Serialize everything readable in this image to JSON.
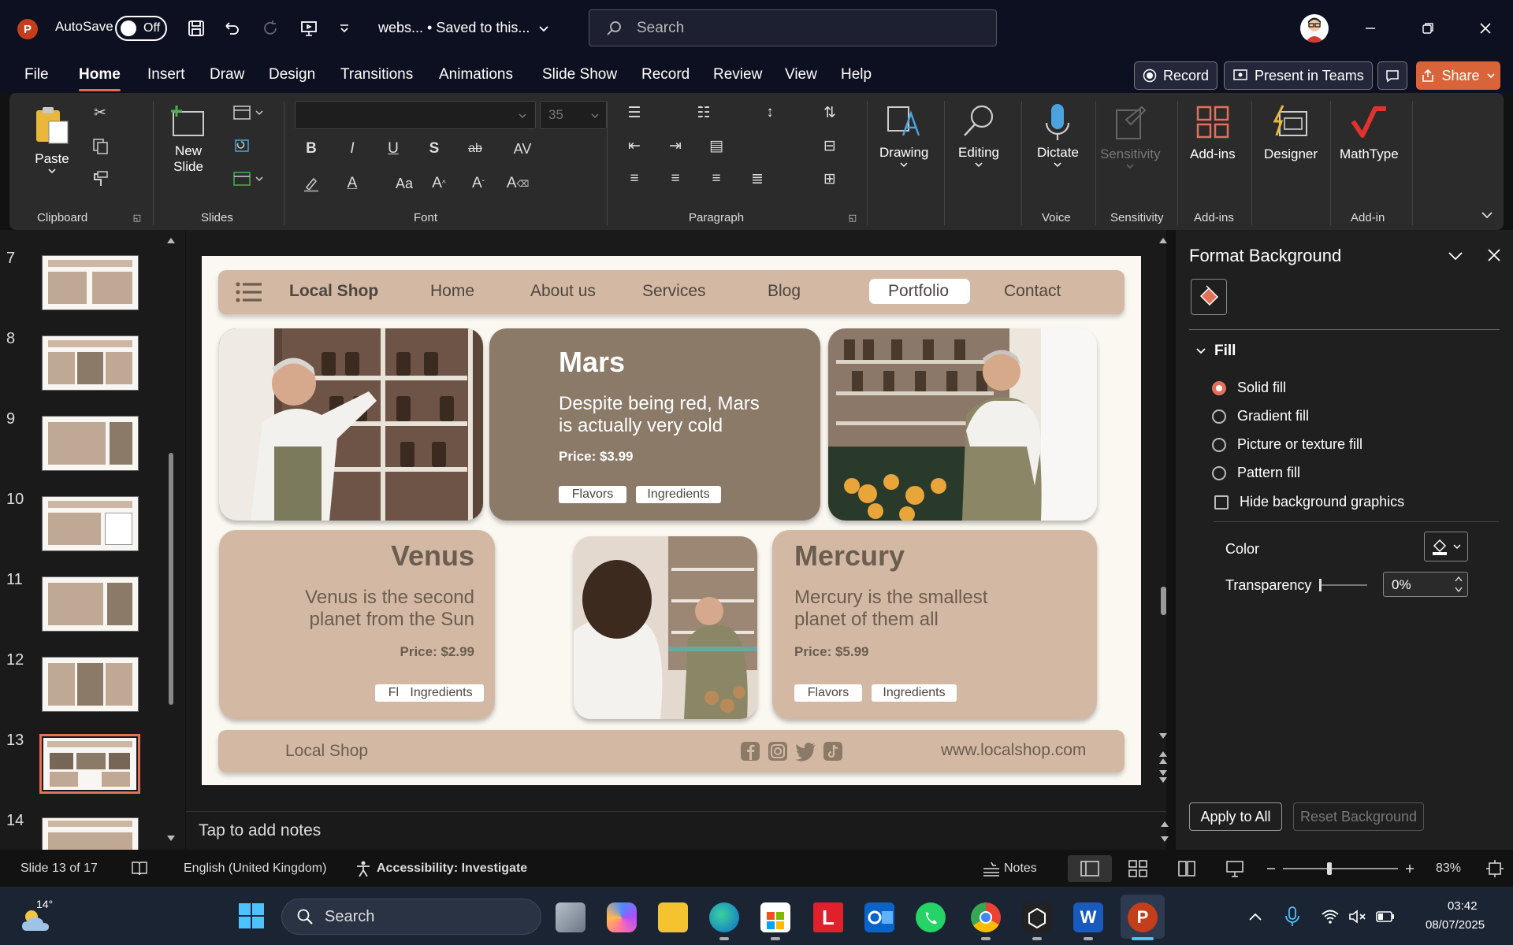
{
  "titlebar": {
    "app_logo": "P",
    "autosave_label": "AutoSave",
    "autosave_state": "Off",
    "doc_title": "webs... • Saved to this...",
    "search_placeholder": "Search"
  },
  "menu": {
    "items": [
      "File",
      "Home",
      "Insert",
      "Draw",
      "Design",
      "Transitions",
      "Animations",
      "Slide Show",
      "Record",
      "Review",
      "View",
      "Help"
    ],
    "active": "Home",
    "record_button": "Record",
    "present_button": "Present in Teams",
    "share_button": "Share"
  },
  "ribbon": {
    "groups": {
      "clipboard": "Clipboard",
      "slides": "Slides",
      "font": "Font",
      "paragraph": "Paragraph",
      "voice": "Voice",
      "sensitivity": "Sensitivity",
      "addins": "Add-ins",
      "addin": "Add-in"
    },
    "paste": "Paste",
    "new_slide_1": "New",
    "new_slide_2": "Slide",
    "font_size": "35",
    "drawing": "Drawing",
    "editing": "Editing",
    "dictate": "Dictate",
    "sensitivity": "Sensitivity",
    "addins": "Add-ins",
    "designer": "Designer",
    "mathtype": "MathType"
  },
  "thumbnails": {
    "numbers": [
      "7",
      "8",
      "9",
      "10",
      "11",
      "12",
      "13",
      "14"
    ],
    "selected": "13"
  },
  "slide": {
    "nav_brand": "Local Shop",
    "nav_links": [
      "Home",
      "About us",
      "Services",
      "Blog",
      "Portfolio",
      "Contact"
    ],
    "active_link": "Portfolio",
    "mars": {
      "title": "Mars",
      "desc_1": "Despite being red, Mars",
      "desc_2": "is actually very cold",
      "price": "Price: $3.99",
      "tags": [
        "Flavors",
        "Ingredients"
      ]
    },
    "venus": {
      "title": "Venus",
      "desc_1": "Venus is the second",
      "desc_2": "planet from the Sun",
      "price": "Price: $2.99",
      "tags": [
        "Flavors",
        "Ingredients"
      ]
    },
    "mercury": {
      "title": "Mercury",
      "desc_1": "Mercury is the smallest",
      "desc_2": "planet of them all",
      "price": "Price: $5.99",
      "tags": [
        "Flavors",
        "Ingredients"
      ]
    },
    "footer_brand": "Local Shop",
    "footer_url": "www.localshop.com"
  },
  "notes_placeholder": "Tap to add notes",
  "format_pane": {
    "title": "Format Background",
    "section": "Fill",
    "options": [
      "Solid fill",
      "Gradient fill",
      "Picture or texture fill",
      "Pattern fill"
    ],
    "selected_option": "Solid fill",
    "hide_graphics": "Hide background graphics",
    "color_label": "Color",
    "transparency_label": "Transparency",
    "transparency_value": "0%",
    "apply_all": "Apply to All",
    "reset": "Reset Background"
  },
  "statusbar": {
    "slide_counter": "Slide 13 of 17",
    "language": "English (United Kingdom)",
    "accessibility": "Accessibility: Investigate",
    "notes": "Notes",
    "zoom": "83%"
  },
  "taskbar": {
    "weather_temp": "14°",
    "search": "Search",
    "time": "03:42",
    "date": "08/07/2025"
  },
  "colors": {
    "accent": "#e2715a",
    "share": "#d9643a",
    "slide_tan": "#d3b9a3",
    "slide_dark": "#8b7a68",
    "ppt_red": "#c43e1c"
  }
}
